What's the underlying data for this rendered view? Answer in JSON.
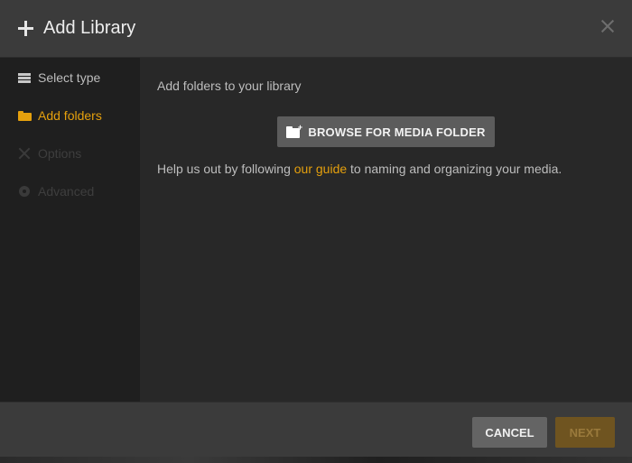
{
  "header": {
    "title": "Add Library"
  },
  "sidebar": {
    "items": [
      {
        "label": "Select type",
        "state": "done",
        "icon": "library-stack-icon"
      },
      {
        "label": "Add folders",
        "state": "active",
        "icon": "folder-icon"
      },
      {
        "label": "Options",
        "state": "disabled",
        "icon": "wrench-icon"
      },
      {
        "label": "Advanced",
        "state": "disabled",
        "icon": "gear-icon"
      }
    ]
  },
  "main": {
    "intro": "Add folders to your library",
    "browse_label": "BROWSE FOR MEDIA FOLDER",
    "help_prefix": "Help us out by following ",
    "help_link": "our guide",
    "help_suffix": " to naming and organizing your media."
  },
  "footer": {
    "cancel_label": "CANCEL",
    "next_label": "NEXT"
  },
  "colors": {
    "accent": "#e5a00d",
    "header_bg": "#3b3b3b",
    "sidebar_bg": "#1f1f1f",
    "content_bg": "#282828"
  }
}
